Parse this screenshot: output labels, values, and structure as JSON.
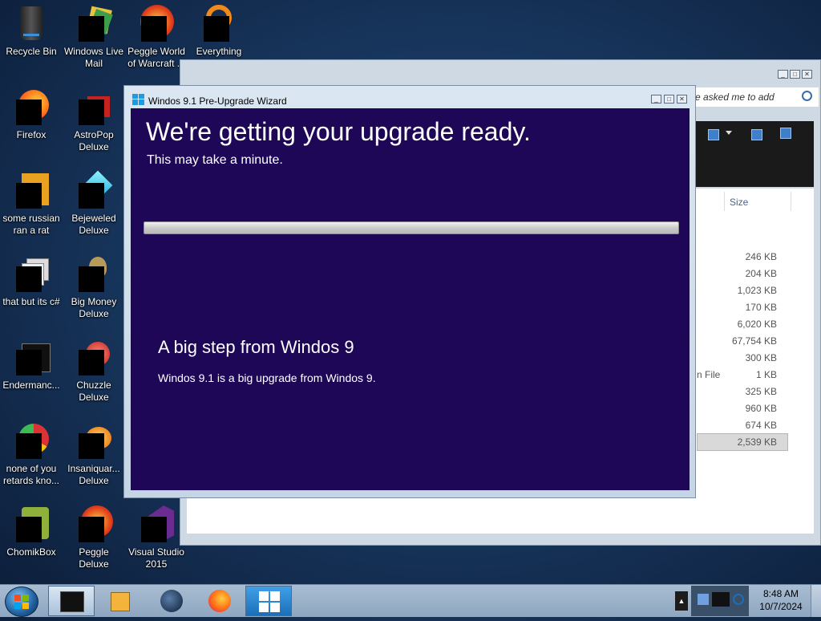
{
  "desktop": {
    "icons": [
      {
        "label": "Recycle Bin"
      },
      {
        "label": "Windows Live Mail"
      },
      {
        "label": "Peggle World of Warcraft ..."
      },
      {
        "label": "Everything"
      },
      {
        "label": "Firefox"
      },
      {
        "label": "AstroPop Deluxe"
      },
      {
        "label": "some russian ran a rat"
      },
      {
        "label": "Bejeweled Deluxe"
      },
      {
        "label": "that but its c#"
      },
      {
        "label": "Big Money Deluxe"
      },
      {
        "label": "Endermanc..."
      },
      {
        "label": "Chuzzle Deluxe"
      },
      {
        "label": "none of you retards kno..."
      },
      {
        "label": "Insaniquar... Deluxe"
      },
      {
        "label": "ChomikBox"
      },
      {
        "label": "Peggle Deluxe"
      },
      {
        "label": "Visual Studio 2015"
      }
    ]
  },
  "explorer": {
    "search_placeholder": "e asked me to add",
    "column_size": "Size",
    "partial_type": "n File",
    "sizes": [
      "246 KB",
      "204 KB",
      "1,023 KB",
      "170 KB",
      "6,020 KB",
      "67,754 KB",
      "300 KB",
      "1 KB",
      "325 KB",
      "960 KB",
      "674 KB",
      "2,539 KB"
    ]
  },
  "wizard": {
    "window_title": "Windos 9.1 Pre-Upgrade Wizard",
    "heading": "We're getting your upgrade ready.",
    "subheading": "This may take a minute.",
    "progress_fraction": 0.0,
    "step_heading": "A big step from Windos 9",
    "step_body": "Windos 9.1 is a big upgrade from Windos 9."
  },
  "taskbar": {
    "time": "8:48 AM",
    "date": "10/7/2024"
  },
  "colors": {
    "wizard_panel": "#1d0756",
    "desktop_bg": "#18375f"
  }
}
